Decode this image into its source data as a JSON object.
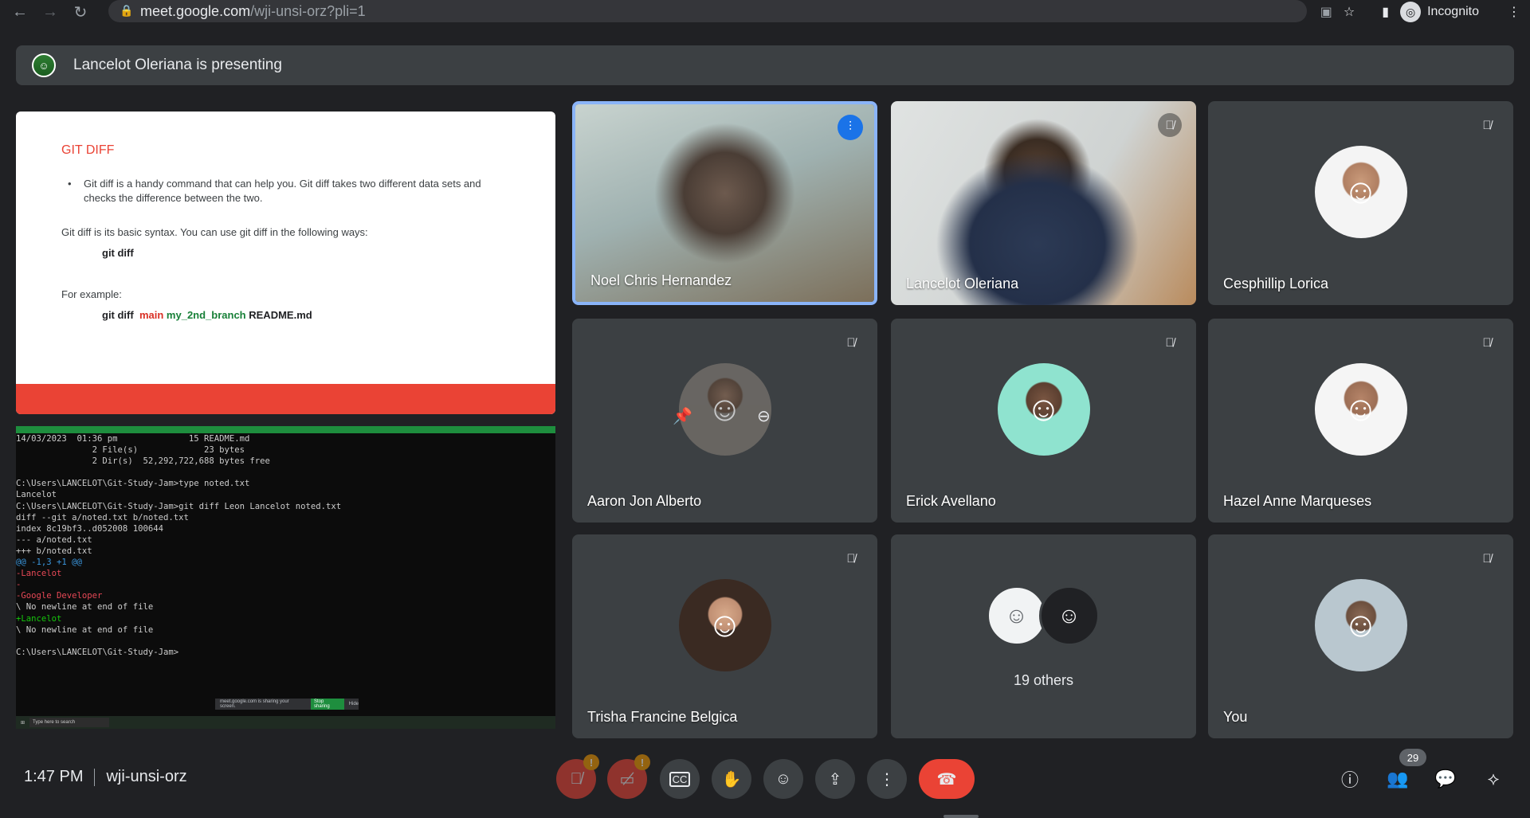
{
  "browser": {
    "url_host": "meet.google.com",
    "url_path": "/wji-unsi-orz?pli=1",
    "profile_label": "Incognito"
  },
  "presenting": {
    "text": "Lancelot Oleriana is presenting"
  },
  "slide": {
    "title": "GIT DIFF",
    "bullet": "Git diff is a handy command that can help you. Git diff takes two different data sets and checks the difference between the two.",
    "syntax_line": "Git diff is its basic syntax. You can use git diff in the following ways:",
    "code1": "git diff",
    "example_label": "For example:",
    "code2_cmd": "git diff",
    "code2_branch1": "main",
    "code2_branch2": "my_2nd_branch",
    "code2_file": "README.md",
    "accent_color": "#ea4335"
  },
  "terminal": {
    "lines": [
      "14/03/2023  01:36 pm              15 README.md",
      "               2 File(s)             23 bytes",
      "               2 Dir(s)  52,292,722,688 bytes free",
      "",
      "C:\\Users\\LANCELOT\\Git-Study-Jam>type noted.txt",
      "Lancelot",
      "C:\\Users\\LANCELOT\\Git-Study-Jam>git diff Leon Lancelot noted.txt",
      "diff --git a/noted.txt b/noted.txt",
      "index 8c19bf3..d052008 100644",
      "--- a/noted.txt",
      "+++ b/noted.txt"
    ],
    "hunk": "@@ -1,3 +1 @@",
    "removed1": "-Lancelot",
    "removed2": "-",
    "removed3": "-Google Developer",
    "nonewline1": "\\ No newline at end of file",
    "added": "+Lancelot",
    "nonewline2": "\\ No newline at end of file",
    "prompt": "C:\\Users\\LANCELOT\\Git-Study-Jam>",
    "share_toast": "meet.google.com is sharing your screen.",
    "stop_sharing": "Stop sharing",
    "hide": "Hide",
    "taskbar_search": "Type here to search"
  },
  "participants": [
    {
      "name": "Noel Chris Hernandez",
      "speaking": true
    },
    {
      "name": "Lancelot Oleriana",
      "muted": true
    },
    {
      "name": "Cesphillip Lorica",
      "muted": true
    },
    {
      "name": "Aaron Jon Alberto",
      "muted": true
    },
    {
      "name": "Erick Avellano",
      "muted": true
    },
    {
      "name": "Hazel Anne Marqueses",
      "muted": true
    },
    {
      "name": "Trisha Francine Belgica",
      "muted": true
    },
    {
      "name": "You",
      "muted": true
    }
  ],
  "others": {
    "label": "19 others"
  },
  "bottom": {
    "time": "1:47 PM",
    "meeting_code": "wji-unsi-orz",
    "participant_count": "29",
    "hangup_color": "#ea4335",
    "warning_color": "#f29900"
  },
  "icons": {
    "back": "back-arrow-icon",
    "forward": "forward-arrow-icon",
    "reload": "reload-icon",
    "lock": "lock-icon",
    "star": "star-icon",
    "menu": "more-vert-icon"
  }
}
